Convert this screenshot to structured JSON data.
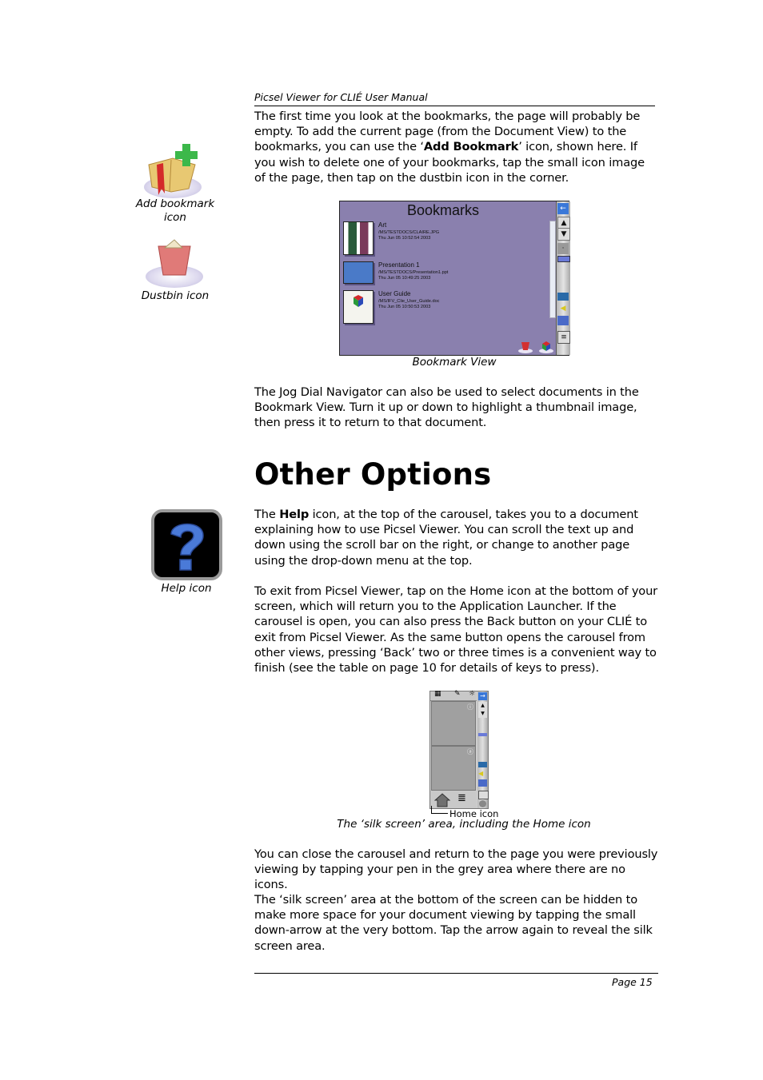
{
  "header": {
    "running_title": "Picsel Viewer for CLIÉ User Manual"
  },
  "sidebar_icons": {
    "add_bookmark_caption": "Add bookmark icon",
    "dustbin_caption": "Dustbin icon",
    "help_caption": "Help icon"
  },
  "paragraphs": {
    "p1_part1": "The first time you look at the bookmarks, the page will probably be empty.  To add the current page (from the Document View) to the bookmarks, you can use the ‘",
    "p1_bold": "Add Bookmark",
    "p1_part2": "’ icon, shown here.  If you wish to delete one of your bookmarks, tap the small icon image of the page, then tap on the dustbin icon in the corner.",
    "p2": "The Jog Dial Navigator can also be used to select documents in the Bookmark View. Turn it up or down to highlight a thumbnail image, then press it to return to that document.",
    "p3_part1": "The ",
    "p3_bold": "Help",
    "p3_part2": " icon, at the top of the carousel, takes you to a document explaining how to use Picsel Viewer.  You can scroll the text up and down using the scroll bar on the right, or change to another page using the drop-down menu at the top.",
    "p4": "To exit from Picsel Viewer, tap on the Home icon at the bottom of your screen, which will return you to the Application Launcher. If the carousel is open, you can also press the Back button on your CLIÉ to exit from Picsel Viewer. As the same button opens the carousel from other views, pressing ‘Back’ two or three times is a convenient way to finish (see the table on page 10 for details of keys to press).",
    "p5": "You can close the carousel and return to the page you were previously viewing by tapping your pen in the grey area where there are no icons.",
    "p6": "The ‘silk screen’ area at the bottom of the screen can be hidden to make more space for your document viewing by tapping the small down-arrow at the very bottom. Tap the arrow again to reveal the silk screen area."
  },
  "section_heading": "Other Options",
  "bookmark_view": {
    "title": "Bookmarks",
    "caption": "Bookmark View",
    "items": [
      {
        "name": "Art",
        "path": "/MS/TESTDOCS/CLAIRE.JPG",
        "date": "Thu Jun 05 10:52:54 2003"
      },
      {
        "name": "Presentation 1",
        "path": "/MS/TESTDOCS/Presentation1.ppt",
        "date": "Thu Jun 05 10:49:25 2003"
      },
      {
        "name": "User Guide",
        "path": "/MS/IFV_Clie_User_Guide.doc",
        "date": "Thu Jun 05 10:50:53 2003"
      }
    ],
    "colors": {
      "background": "#8a80ae",
      "accent": "#3a78d8"
    }
  },
  "silk_screen": {
    "home_label": "Home icon",
    "caption": "The ‘silk screen’ area, including the Home icon"
  },
  "footer": {
    "page_number": "Page 15"
  }
}
